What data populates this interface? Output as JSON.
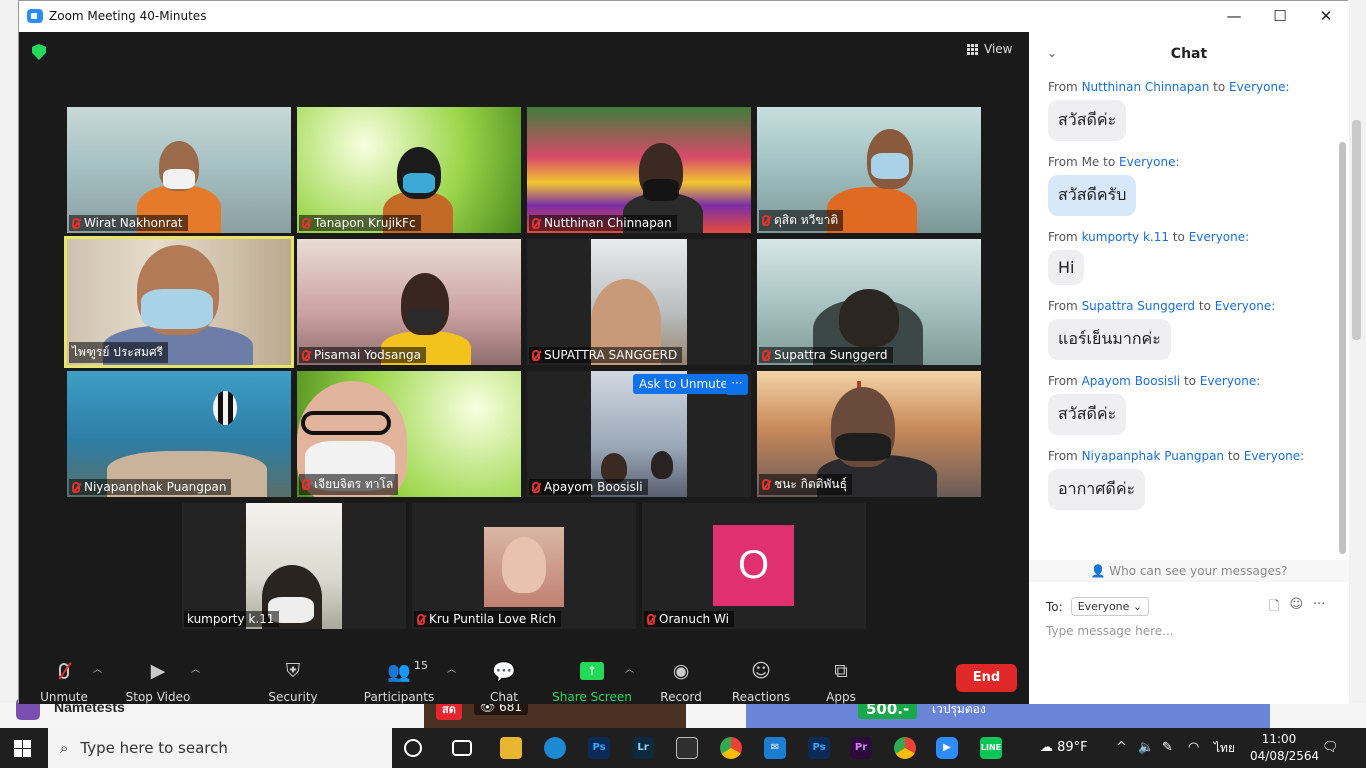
{
  "window": {
    "title": "Zoom Meeting 40-Minutes",
    "minimize": "—",
    "maximize": "☐",
    "close": "✕"
  },
  "view_label": "View",
  "tiles": [
    {
      "name": "Wirat Nakhonrat"
    },
    {
      "name": "Tanapon KrujikFc"
    },
    {
      "name": "Nutthinan Chinnapan"
    },
    {
      "name": "ดุสิต หวีขาติ"
    },
    {
      "name": "ไพฑูรย์ ประสมศรี"
    },
    {
      "name": "Pisamai Yodsanga"
    },
    {
      "name": "SUPATTRA SANGGERD"
    },
    {
      "name": "Supattra Sunggerd"
    },
    {
      "name": "Niyapanphak Puangpan"
    },
    {
      "name": "เจียบจิตร ทาโล"
    },
    {
      "name": "Apayom Boosisli"
    },
    {
      "name": "ชนะ กิตติพันธุ์"
    },
    {
      "name": "kumporty k.11"
    },
    {
      "name": "Kru Puntila Love Rich"
    },
    {
      "name": "Oranuch Wi",
      "avatar_letter": "O"
    }
  ],
  "ask_to_unmute": "Ask to Unmute",
  "more_label": "···",
  "toolbar": {
    "unmute": "Unmute",
    "stop_video": "Stop Video",
    "security": "Security",
    "participants": "Participants",
    "participants_count": "15",
    "chat": "Chat",
    "share_screen": "Share Screen",
    "record": "Record",
    "reactions": "Reactions",
    "apps": "Apps",
    "end": "End"
  },
  "chat": {
    "title": "Chat",
    "messages": [
      {
        "from_prefix": "From",
        "sender": "Nutthinan Chinnapan",
        "to_word": "to",
        "recipient": "Everyone:",
        "text": "สวัสดีค่ะ"
      },
      {
        "from_prefix": "From",
        "sender": "Me",
        "to_word": "to",
        "recipient": "Everyone:",
        "text": "สวัสดีครับ"
      },
      {
        "from_prefix": "From",
        "sender": "kumporty k.11",
        "to_word": "to",
        "recipient": "Everyone:",
        "text": "Hi"
      },
      {
        "from_prefix": "From",
        "sender": "Supattra Sunggerd",
        "to_word": "to",
        "recipient": "Everyone:",
        "text": "แอร์เย็นมากค่ะ"
      },
      {
        "from_prefix": "From",
        "sender": "Apayom Boosisli",
        "to_word": "to",
        "recipient": "Everyone:",
        "text": "สวัสดีค่ะ"
      },
      {
        "from_prefix": "From",
        "sender": "Niyapanphak Puangpan",
        "to_word": "to",
        "recipient": "Everyone:",
        "text": "อากาศดีค่ะ"
      }
    ],
    "who_can_see": "Who can see your messages?",
    "to_label": "To:",
    "to_value": "Everyone",
    "input_placeholder": "Type message here..."
  },
  "background": {
    "nametests": "Nametests",
    "live": "สด",
    "views": "681",
    "promo": "500.-",
    "promo_text": "เวปรุมตอง"
  },
  "taskbar": {
    "search_placeholder": "Type here to search",
    "temperature": "89°F",
    "language": "ไทย",
    "time": "11:00",
    "date": "04/08/2564"
  },
  "colors": {
    "accent": "#0e72ed",
    "end": "#e02828",
    "share": "#23d959",
    "avatar_o": "#e0306e"
  }
}
